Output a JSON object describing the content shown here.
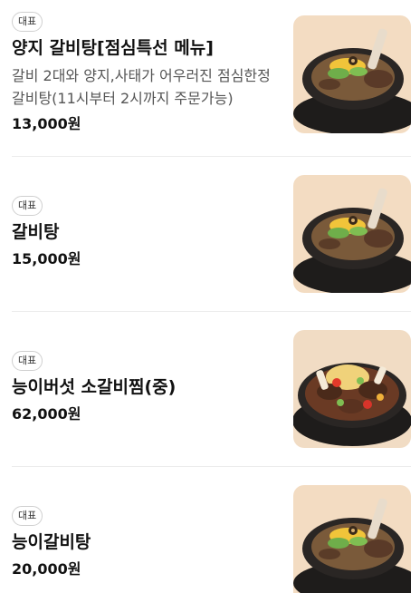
{
  "menu": {
    "items": [
      {
        "badge": "대표",
        "name": "양지 갈비탕[점심특선 메뉴]",
        "description": "갈비 2대와 양지,사태가 어우러진 점심한정 갈비탕(11시부터 2시까지 주문가능)",
        "price": "13,000원",
        "image": "galbitang-photo"
      },
      {
        "badge": "대표",
        "name": "갈비탕",
        "price": "15,000원",
        "image": "galbitang-photo"
      },
      {
        "badge": "대표",
        "name": "능이버섯 소갈비찜(중)",
        "price": "62,000원",
        "image": "galbijjim-photo"
      },
      {
        "badge": "대표",
        "name": "능이갈비탕",
        "price": "20,000원",
        "image": "galbitang-photo"
      }
    ]
  },
  "colors": {
    "badge_border": "#cfcfcf",
    "name": "#111111",
    "description": "#555555",
    "photo_background": "#f3dcc2",
    "pot": "#1e1c1b"
  }
}
